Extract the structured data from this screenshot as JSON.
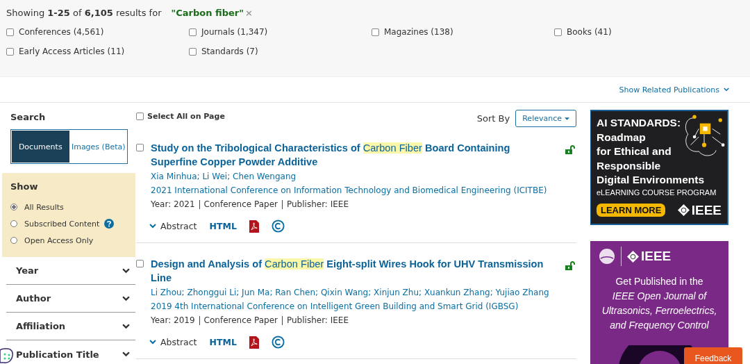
{
  "summary": {
    "text": "Showing **1-25** of  **6,105**  results for",
    "query": "\"Carbon fiber\"",
    "clear": "×"
  },
  "content_types": [
    {
      "label": "Conferences (4,561)",
      "checked": false
    },
    {
      "label": "Journals (1,347)",
      "checked": false
    },
    {
      "label": "Magazines (138)",
      "checked": false
    },
    {
      "label": "Books (41)",
      "checked": false
    },
    {
      "label": "Early Access Articles (11)",
      "checked": false
    },
    {
      "label": "Standards (7)",
      "checked": false
    }
  ],
  "related_publications": "Show Related Publications",
  "sidebar": {
    "search_heading": "Search",
    "search_tabs": [
      {
        "label": "Documents",
        "selected": true
      },
      {
        "label": "Images (Beta)",
        "selected": false
      }
    ],
    "show_heading": "Show",
    "show_options": [
      {
        "label": "All Results",
        "selected": true,
        "help": false
      },
      {
        "label": "Subscribed Content",
        "selected": false,
        "help": true
      },
      {
        "label": "Open Access Only",
        "selected": false,
        "help": false
      }
    ],
    "filters": [
      {
        "label": "Year",
        "expanded": false
      },
      {
        "label": "Author",
        "expanded": false
      },
      {
        "label": "Affiliation",
        "expanded": false
      },
      {
        "label": "Publication Title",
        "expanded": false
      }
    ]
  },
  "select_all": {
    "label": "Select All on Page",
    "checked": false
  },
  "sort": {
    "label": "Sort By",
    "value": "Relevance"
  },
  "results": [
    {
      "checked": false,
      "open_access": true,
      "title": [
        {
          "text": "Study on the Tribological Characteristics of ",
          "highlight": false
        },
        {
          "text": "Carbon Fiber",
          "highlight": true
        },
        {
          "text": " Board Containing Superfine Copper Powder Additive",
          "highlight": false
        }
      ],
      "authors": "Xia Minhua; Li Wei; Chen Wengang",
      "venue": "2021 International Conference on Information Technology and Biomedical Engineering (ICITBE)",
      "year": "Year: 2021",
      "type": "Conference Paper",
      "publisher": "Publisher:  IEEE",
      "abstract": "Abstract",
      "html": "HTML"
    },
    {
      "checked": false,
      "open_access": true,
      "title": [
        {
          "text": "Design and Analysis of ",
          "highlight": false
        },
        {
          "text": "Carbon Fiber",
          "highlight": true
        },
        {
          "text": " Eight-split Wires Hook for UHV Transmission Line",
          "highlight": false
        }
      ],
      "authors": "Li Zhou; Zhonggui Li; Jun Ma; Ran Chen; Qixin Wang; Xinjun Zhu; Xuankun Zhang; Yujiao Zhang",
      "venue": "2019 4th International Conference on Intelligent Green Building and Smart Grid (IGBSG)",
      "year": "Year: 2019",
      "type": "Conference Paper",
      "publisher": "Publisher:  IEEE",
      "abstract": "Abstract",
      "html": "HTML"
    }
  ],
  "ads": [
    {
      "kind": "course",
      "headline": [
        "AI STANDARDS:",
        "Roadmap",
        "for Ethical and",
        "Responsible",
        "Digital Environments"
      ],
      "subtitle": "eLEARNING COURSE PROGRAM",
      "button": "LEARN MORE",
      "brand": "IEEE"
    },
    {
      "kind": "journal",
      "brand": "IEEE",
      "lines": [
        "Get Published in the",
        "IEEE Open Journal of",
        "Ultrasonics, Ferroelectrics,",
        "and Frequency Control"
      ]
    }
  ],
  "feedback": "Feedback"
}
